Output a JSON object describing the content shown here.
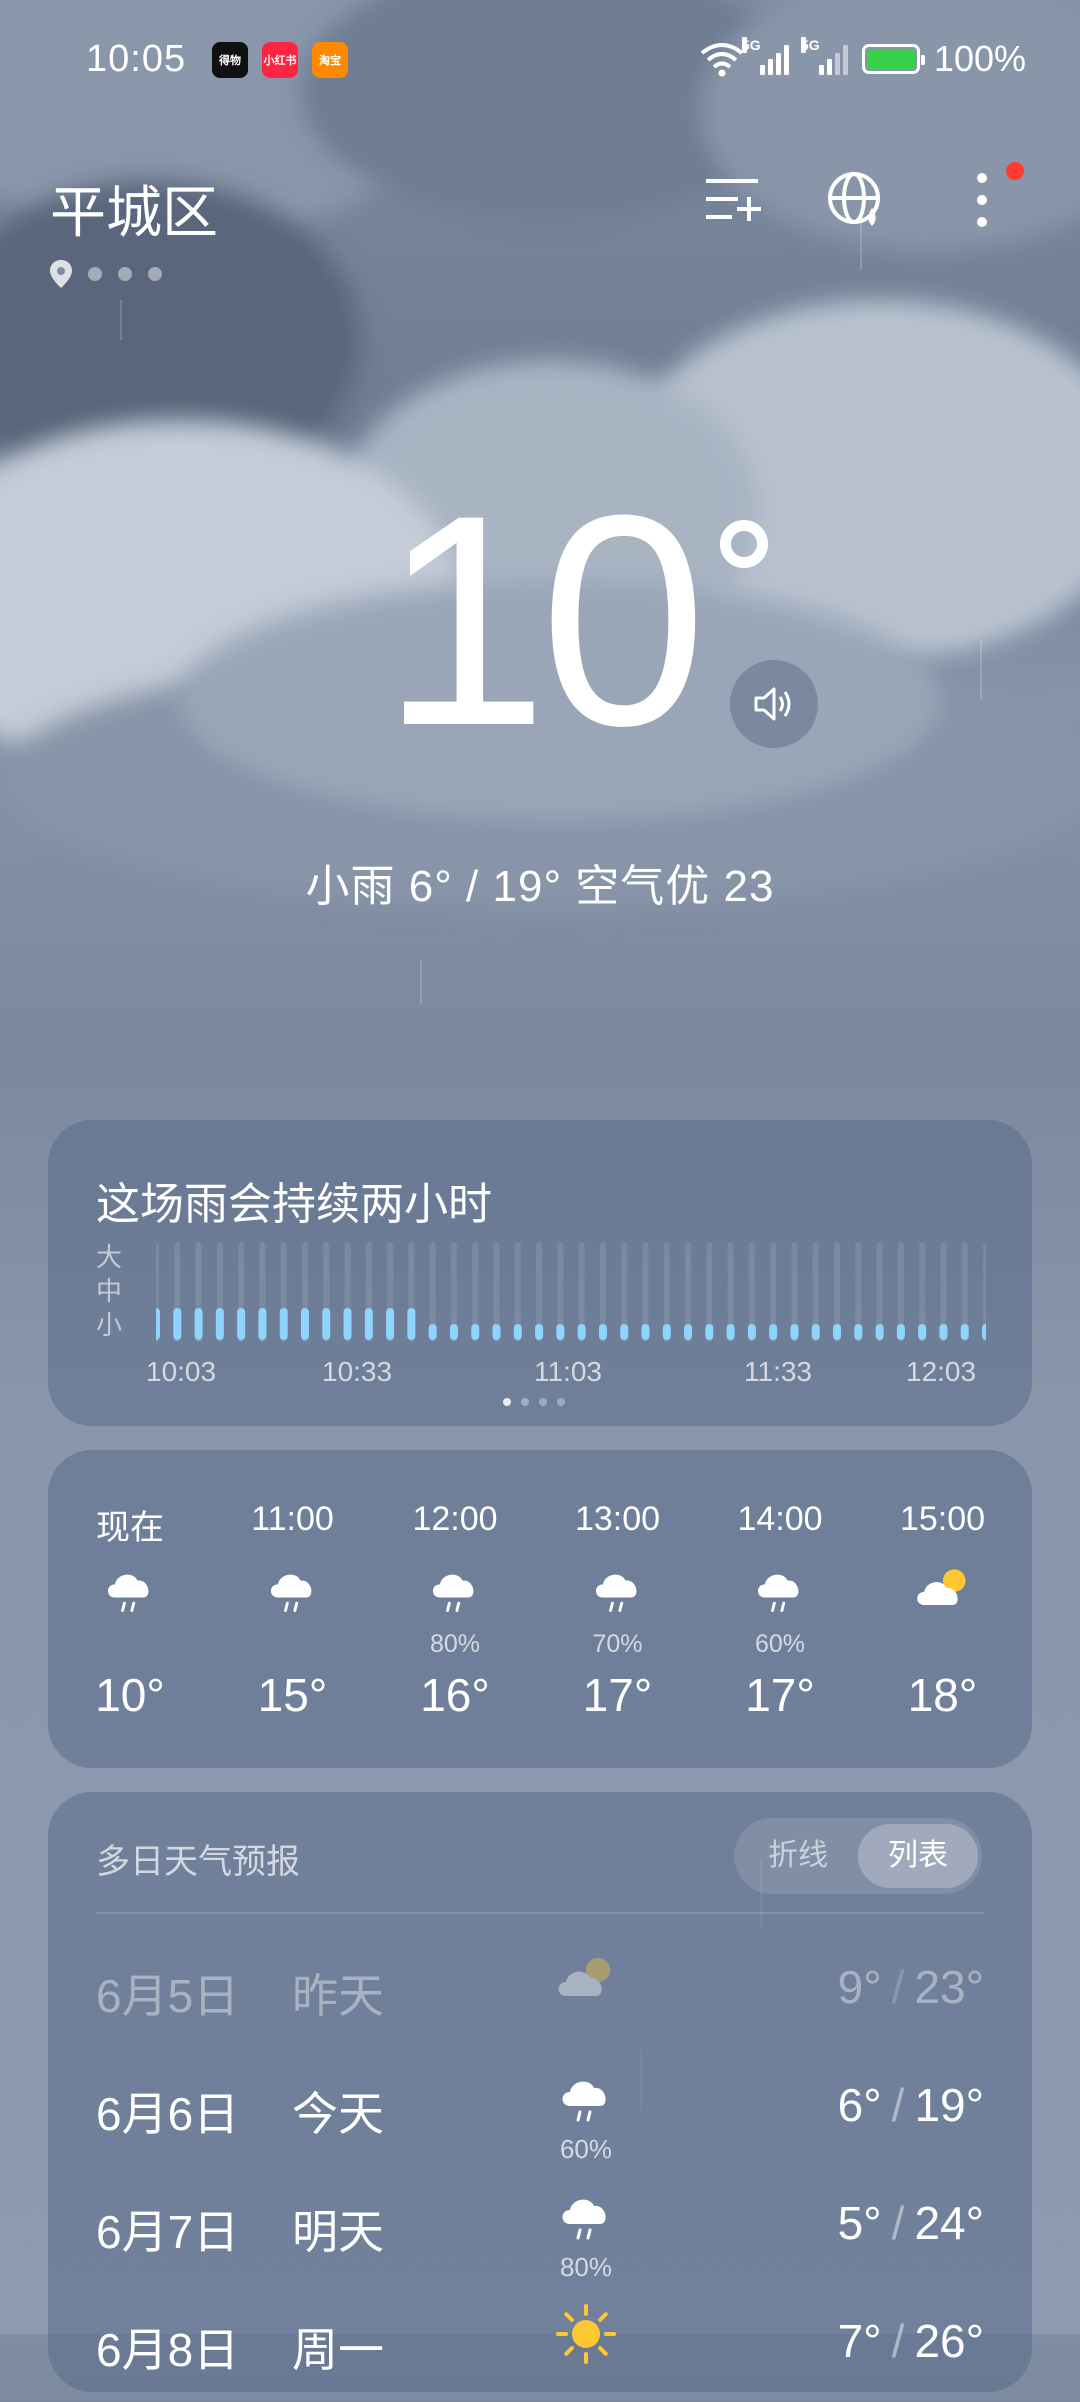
{
  "status_bar": {
    "time": "10:05",
    "apps": [
      "得物",
      "小红书",
      "淘宝"
    ],
    "network_tags": [
      "5G",
      "5G"
    ],
    "battery": "100%",
    "battery_color": "#38d24a"
  },
  "header": {
    "city": "平城区",
    "icons": [
      "add-city-icon",
      "globe-icon",
      "more-icon"
    ],
    "notification_dot_color": "#ff3b30"
  },
  "current": {
    "temp": "10",
    "summary": "小雨  6° / 19°  空气优 23"
  },
  "rain_card": {
    "title": "这场雨会持续两小时",
    "levels": [
      "大",
      "中",
      "小"
    ],
    "time_labels": [
      "10:03",
      "10:33",
      "11:03",
      "11:33",
      "12:03"
    ],
    "bar_color": "#8fd3ff"
  },
  "hourly": [
    {
      "time": "现在",
      "icon": "rain-icon",
      "precip": "",
      "temp": "10°"
    },
    {
      "time": "11:00",
      "icon": "rain-icon",
      "precip": "",
      "temp": "15°"
    },
    {
      "time": "12:00",
      "icon": "rain-icon",
      "precip": "80%",
      "temp": "16°"
    },
    {
      "time": "13:00",
      "icon": "rain-icon",
      "precip": "70%",
      "temp": "17°"
    },
    {
      "time": "14:00",
      "icon": "rain-icon",
      "precip": "60%",
      "temp": "17°"
    },
    {
      "time": "15:00",
      "icon": "partly-cloudy-icon",
      "precip": "",
      "temp": "18°"
    }
  ],
  "daily": {
    "title": "多日天气预报",
    "toggle": [
      "折线",
      "列表"
    ],
    "selected_toggle": "列表",
    "rows": [
      {
        "date": "6月5日",
        "day": "昨天",
        "icon": "partly-cloudy-icon",
        "precip": "",
        "low": "9°",
        "high": "23°",
        "past": true
      },
      {
        "date": "6月6日",
        "day": "今天",
        "icon": "rain-icon",
        "precip": "60%",
        "low": "6°",
        "high": "19°",
        "past": false
      },
      {
        "date": "6月7日",
        "day": "明天",
        "icon": "rain-icon",
        "precip": "80%",
        "low": "5°",
        "high": "24°",
        "past": false
      },
      {
        "date": "6月8日",
        "day": "周一",
        "icon": "sunny-icon",
        "precip": "",
        "low": "7°",
        "high": "26°",
        "past": false
      }
    ]
  }
}
